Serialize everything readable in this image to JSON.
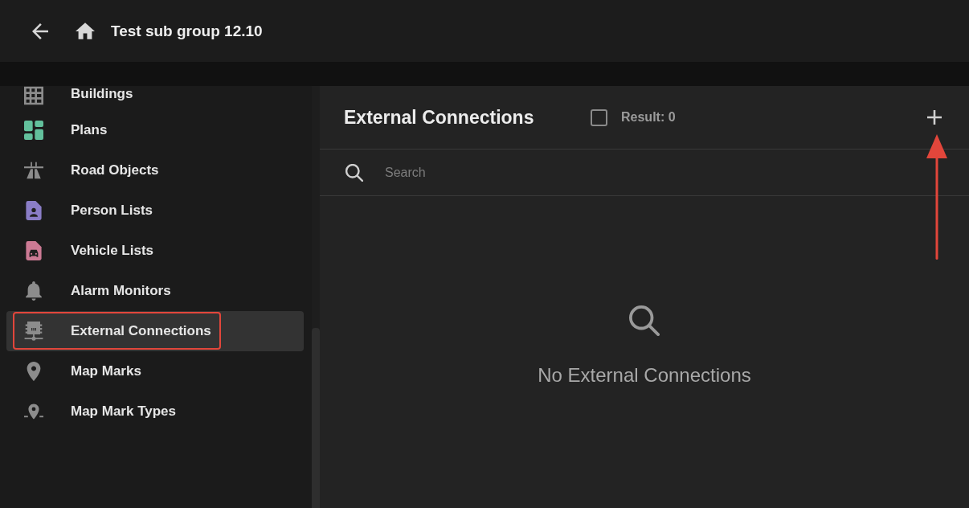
{
  "header": {
    "title": "Test sub group 12.10"
  },
  "sidebar": {
    "items": [
      {
        "label": "Buildings",
        "color": "#8c8c8c",
        "selected": false
      },
      {
        "label": "Plans",
        "color": "#62c09c",
        "selected": false
      },
      {
        "label": "Road Objects",
        "color": "#8c8c8c",
        "selected": false
      },
      {
        "label": "Person Lists",
        "color": "#8a7dc6",
        "selected": false
      },
      {
        "label": "Vehicle Lists",
        "color": "#cc7a94",
        "selected": false
      },
      {
        "label": "Alarm Monitors",
        "color": "#8c8c8c",
        "selected": false
      },
      {
        "label": "External Connections",
        "color": "#8c8c8c",
        "selected": true
      },
      {
        "label": "Map Marks",
        "color": "#8c8c8c",
        "selected": false
      },
      {
        "label": "Map Mark Types",
        "color": "#8c8c8c",
        "selected": false
      }
    ]
  },
  "panel": {
    "title": "External Connections",
    "select_all": {
      "checked": false
    },
    "result": "Result: 0",
    "search": {
      "placeholder": "Search"
    },
    "empty_state": {
      "message": "No External Connections"
    }
  }
}
